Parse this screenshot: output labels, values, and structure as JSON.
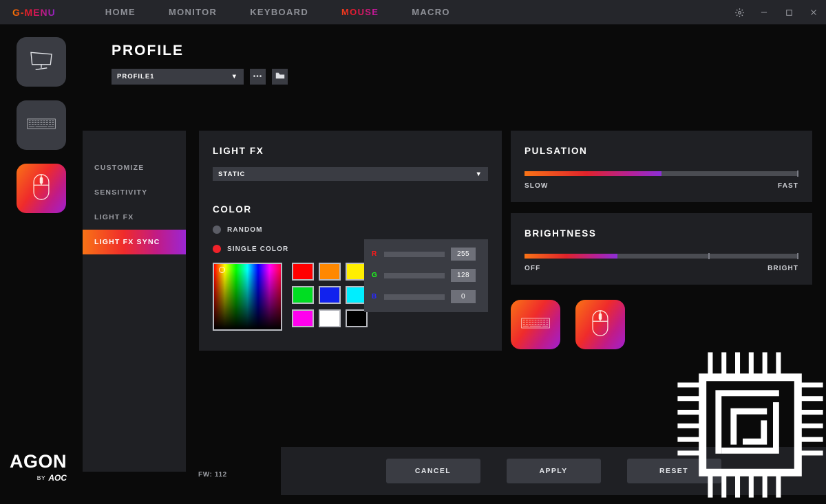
{
  "app": {
    "logo": "G-MENU",
    "firmware": "FW: 112",
    "brand_word": "AGON",
    "brand_by": "BY",
    "brand_company": "AOC"
  },
  "nav_tabs": [
    {
      "label": "HOME",
      "active": false
    },
    {
      "label": "MONITOR",
      "active": false
    },
    {
      "label": "KEYBOARD",
      "active": false
    },
    {
      "label": "MOUSE",
      "active": true
    },
    {
      "label": "MACRO",
      "active": false
    }
  ],
  "window_controls": [
    {
      "name": "settings-gear",
      "glyph": "gear"
    },
    {
      "name": "minimize",
      "glyph": "minus"
    },
    {
      "name": "maximize",
      "glyph": "square"
    },
    {
      "name": "close",
      "glyph": "x"
    }
  ],
  "device_rail": [
    {
      "name": "monitor",
      "active": false
    },
    {
      "name": "keyboard",
      "active": false
    },
    {
      "name": "mouse",
      "active": true
    }
  ],
  "profile": {
    "title": "PROFILE",
    "selected": "PROFILE1",
    "caret": "▼",
    "more_button": "•••",
    "folder_button": "folder"
  },
  "sidenav": {
    "items": [
      {
        "label": "CUSTOMIZE",
        "active": false
      },
      {
        "label": "SENSITIVITY",
        "active": false
      },
      {
        "label": "LIGHT FX",
        "active": false
      },
      {
        "label": "LIGHT FX SYNC",
        "active": true
      }
    ]
  },
  "light_fx": {
    "title": "LIGHT FX",
    "mode_selected": "STATIC",
    "caret": "▼",
    "color_title": "COLOR",
    "options": [
      {
        "label": "RANDOM",
        "selected": false
      },
      {
        "label": "SINGLE COLOR",
        "selected": true
      }
    ],
    "swatches": [
      "#ff0000",
      "#ff8800",
      "#ffee00",
      "#00dd22",
      "#1122ee",
      "#00eeff",
      "#ff00ee",
      "#ffffff",
      "#000000"
    ],
    "rgb": [
      {
        "channel": "R",
        "value": "255",
        "percent": 100,
        "color": "#ff1a1a"
      },
      {
        "channel": "G",
        "value": "128",
        "percent": 50,
        "color": "#1aff1a"
      },
      {
        "channel": "B",
        "value": "0",
        "percent": 0,
        "color": "#2a2aff"
      }
    ]
  },
  "pulsation": {
    "title": "PULSATION",
    "fill_percent": 50,
    "min_label": "SLOW",
    "max_label": "FAST"
  },
  "brightness": {
    "title": "BRIGHTNESS",
    "fill_percent": 34,
    "tick_percent": 67,
    "min_label": "OFF",
    "max_label": "BRIGHT"
  },
  "sync_devices": [
    {
      "name": "keyboard",
      "active": true
    },
    {
      "name": "mouse",
      "active": true
    }
  ],
  "footer_buttons": [
    {
      "label": "CANCEL"
    },
    {
      "label": "APPLY"
    },
    {
      "label": "RESET"
    }
  ],
  "colors": {
    "accent_start": "#f97316",
    "accent_mid": "#ef2b2b",
    "accent_end": "#9b26d4",
    "panel_bg": "#1f2024",
    "app_bg": "#0a0a0a",
    "control_bg": "#3a3c43"
  }
}
